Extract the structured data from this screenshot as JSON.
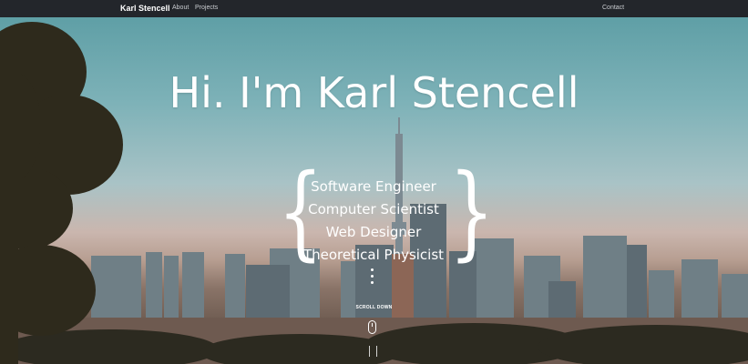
{
  "nav": {
    "brand": "Karl Stencell",
    "links": [
      "About",
      "Projects"
    ],
    "contact": "Contact"
  },
  "hero": {
    "title": "Hi. I'm Karl Stencell",
    "roles": [
      "Software Engineer",
      "Computer Scientist",
      "Web Designer",
      "Theoretical Physicist"
    ],
    "scroll_label": "SCROLL DOWN"
  },
  "colors": {
    "navbar": "#23262b",
    "sky_top": "#5f9fa6",
    "text": "#ffffff"
  }
}
